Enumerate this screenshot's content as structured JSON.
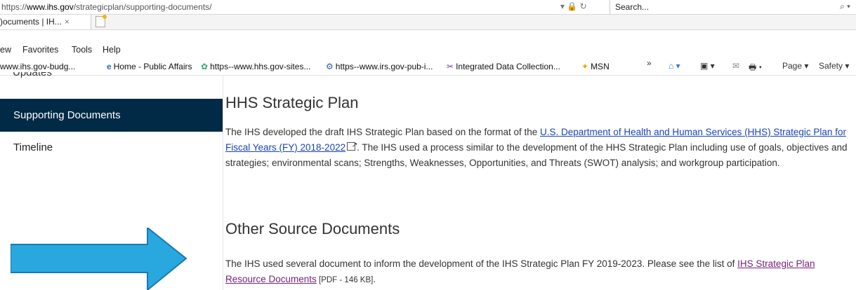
{
  "browser": {
    "url_scheme": "https://",
    "url_host": "www.ihs.gov",
    "url_path": "/strategicplan/supporting-documents/",
    "address_controls": "▾ 🔒 ↻",
    "search_placeholder": "Search...",
    "search_icon": "⌕ ▾",
    "tab_title": ")ocuments | IH...",
    "tab_close": "×",
    "menu": [
      "ew",
      "Favorites",
      "Tools",
      "Help"
    ],
    "favorites": [
      {
        "icon": "",
        "label": "www.ihs.gov-budg..."
      },
      {
        "icon": "e",
        "label": "Home - Public Affairs"
      },
      {
        "icon": "✿",
        "label": "https--www.hhs.gov-sites..."
      },
      {
        "icon": "⚙",
        "label": "https--www.irs.gov-pub-i..."
      },
      {
        "icon": "✂",
        "label": "Integrated Data Collection..."
      },
      {
        "icon": "✦",
        "label": "MSN"
      }
    ],
    "command_bar": {
      "chevron": "»",
      "home": "⌂ ▾",
      "feeds": "▣ ▾",
      "mail": "✉",
      "print": "🖶 ▾",
      "page": "Page ▾",
      "safety": "Safety ▾"
    }
  },
  "sidebar": {
    "cut_item": "Updates",
    "active_item": "Supporting Documents",
    "timeline": "Timeline"
  },
  "content": {
    "heading1": "HHS Strategic Plan",
    "p1_text1": "The IHS developed the draft IHS Strategic Plan based on the format of the ",
    "p1_link": "U.S. Department of Health and Human Services (HHS) Strategic Plan for Fiscal Years (FY) 2018-2022",
    "p1_text2": ". The IHS used a process similar to the development of the HHS Strategic Plan including use of goals, objectives and strategies; environmental scans; Strengths, Weaknesses, Opportunities, and Threats (SWOT) analysis; and workgroup participation.",
    "heading2": "Other Source Documents",
    "p2_text1": "The IHS used several document to inform the development of the IHS Strategic Plan FY 2019-2023. Please see the list of ",
    "p2_link": "IHS Strategic Plan Resource Documents",
    "p2_size": " [PDF - 146 KB]",
    "p2_end": "."
  },
  "colors": {
    "sidebar_active_bg": "#012a46",
    "link": "#1a44b8",
    "visited_link": "#76227b",
    "arrow_fill": "#29a8df"
  }
}
